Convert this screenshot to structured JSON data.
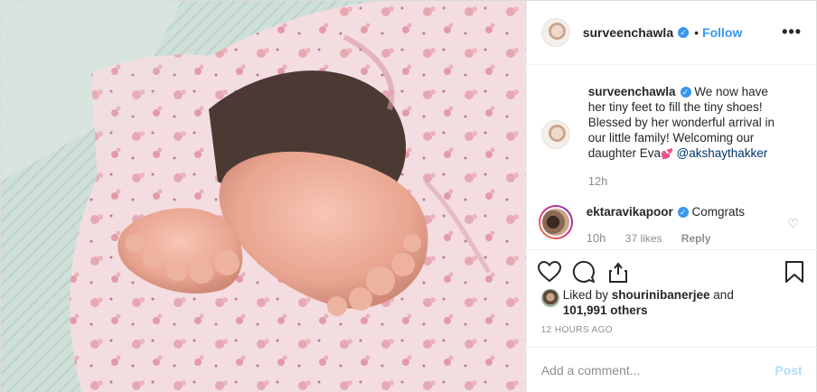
{
  "post": {
    "photo_alt": "Baby feet wrapped in pink floral swaddle blanket",
    "author": {
      "username": "surveenchawla",
      "verified": true,
      "follow_label": "Follow",
      "separator": "•"
    },
    "more_label": "•••",
    "caption": {
      "username": "surveenchawla",
      "text": "We now have her tiny feet to fill the tiny shoes! Blessed by her wonderful arrival in our little family! Welcoming our daughter Eva",
      "heart": "💕",
      "mention": "@akshaythakker",
      "time": "12h"
    },
    "comments": [
      {
        "username": "ektaravikapoor",
        "verified": true,
        "text": "Comgrats",
        "time": "10h",
        "likes": "37 likes",
        "reply_label": "Reply"
      }
    ],
    "likes": {
      "prefix": "Liked by ",
      "user": "shourinibanerjee",
      "middle": " and",
      "count": "101,991 others"
    },
    "timestamp": "12 HOURS AGO",
    "add_comment": {
      "placeholder": "Add a comment...",
      "post_label": "Post"
    },
    "icons": {
      "like": "heart-icon",
      "comment": "comment-icon",
      "share": "share-icon",
      "save": "bookmark-icon",
      "verified": "verified-badge-icon"
    },
    "colors": {
      "link_blue": "#3897f0",
      "post_disabled": "#b2dffc",
      "mention": "#003569",
      "muted": "#8e8e8e"
    }
  }
}
